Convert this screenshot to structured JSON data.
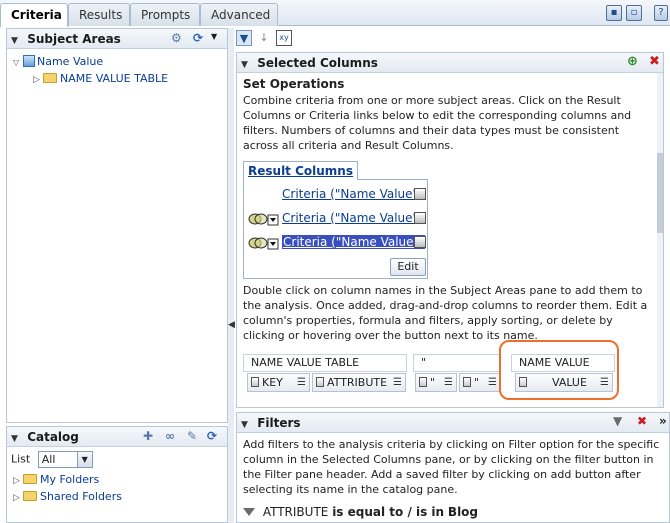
{
  "tabs": [
    {
      "label": "Criteria",
      "active": true
    },
    {
      "label": "Results",
      "active": false
    },
    {
      "label": "Prompts",
      "active": false
    },
    {
      "label": "Advanced",
      "active": false
    }
  ],
  "toolbar_icons": [
    "save-icon",
    "save-as-icon",
    "help-icon"
  ],
  "help_glyph": "?",
  "subject_areas": {
    "title": "Subject Areas",
    "tree": {
      "root": "Name Value",
      "child": "NAME VALUE TABLE"
    }
  },
  "catalog": {
    "title": "Catalog",
    "list_label": "List",
    "list_value": "All",
    "folders": [
      "My Folders",
      "Shared Folders"
    ]
  },
  "selected_columns": {
    "title": "Selected Columns",
    "set_operations_title": "Set Operations",
    "set_operations_text": "Combine criteria from one or more subject areas. Click on the Result Columns or Criteria links below to edit the corresponding columns and filters. Numbers of columns and their data types must be consistent across all criteria and Result Columns.",
    "result_columns_label": "Result Columns",
    "criteria": [
      {
        "label": "Criteria (\"Name Value\")",
        "highlighted": false,
        "has_venn": false
      },
      {
        "label": "Criteria (\"Name Value\")",
        "highlighted": false,
        "has_venn": true
      },
      {
        "label": "Criteria (\"Name Value\")",
        "highlighted": true,
        "has_venn": true
      }
    ],
    "edit_label": "Edit",
    "instructions": "Double click on column names in the Subject Areas pane to add them to the analysis. Once added, drag-and-drop columns to reorder them. Edit a column's properties, formula and filters, apply sorting, or delete by clicking or hovering over the button next to its name.",
    "column_groups": [
      {
        "header": "NAME VALUE TABLE",
        "columns": [
          "KEY",
          "ATTRIBUTE"
        ]
      },
      {
        "header": "\"",
        "columns": [
          "\"",
          "\""
        ]
      },
      {
        "header": "NAME VALUE TABLE",
        "columns": [
          "VALUE"
        ]
      }
    ]
  },
  "filters": {
    "title": "Filters",
    "help_text": "Add filters to the analysis criteria by clicking on Filter option for the specific column in the Selected Columns pane, or by clicking on the filter button in the Filter pane header. Add a saved filter by clicking on add button after selecting its name in the catalog pane.",
    "filter_column": "ATTRIBUTE",
    "filter_operator": "is equal to / is in",
    "filter_value": "Blog"
  },
  "colors": {
    "highlight_bg": "#3a4fbf",
    "link": "#0b3d91",
    "callout_border": "#ee6f2d"
  }
}
